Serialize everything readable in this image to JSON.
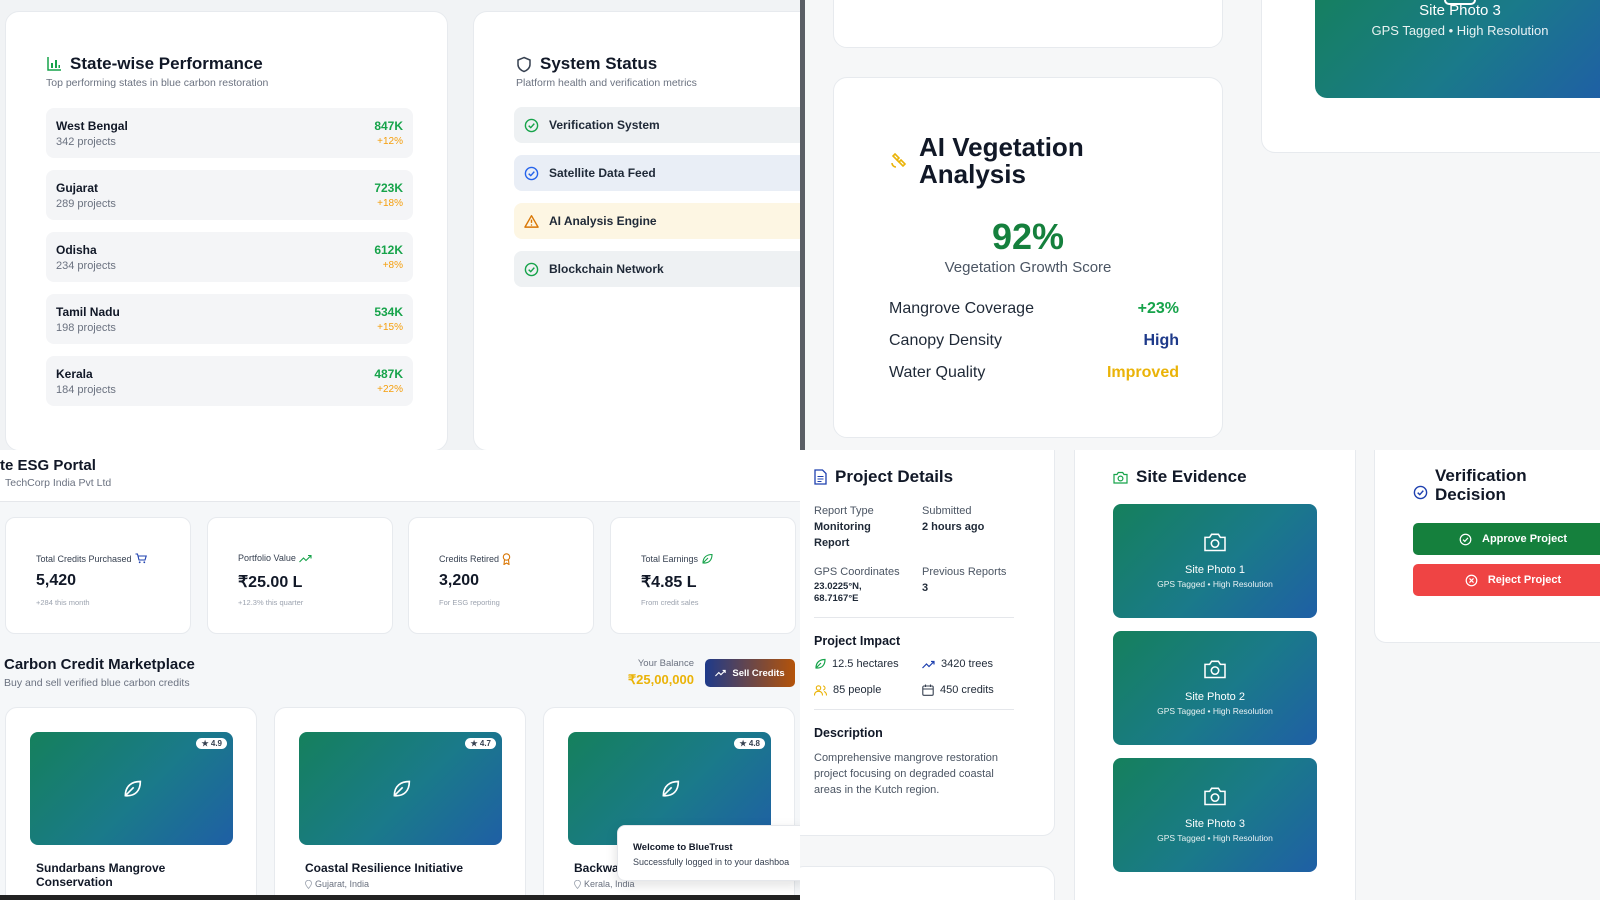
{
  "state_performance": {
    "title": "State-wise Performance",
    "subtitle": "Top performing states in blue carbon restoration",
    "states": [
      {
        "name": "West Bengal",
        "projects": "342 projects",
        "value": "847K",
        "growth": "+12%"
      },
      {
        "name": "Gujarat",
        "projects": "289 projects",
        "value": "723K",
        "growth": "+18%"
      },
      {
        "name": "Odisha",
        "projects": "234 projects",
        "value": "612K",
        "growth": "+8%"
      },
      {
        "name": "Tamil Nadu",
        "projects": "198 projects",
        "value": "534K",
        "growth": "+15%"
      },
      {
        "name": "Kerala",
        "projects": "184 projects",
        "value": "487K",
        "growth": "+22%"
      }
    ]
  },
  "system_status": {
    "title": "System Status",
    "subtitle": "Platform health and verification metrics",
    "items": [
      {
        "label": "Verification System",
        "state": "ok",
        "color": "#16a34a",
        "bg": "#eef1f3"
      },
      {
        "label": "Satellite Data Feed",
        "state": "ok",
        "color": "#2563eb",
        "bg": "#e9eef6"
      },
      {
        "label": "AI Analysis Engine",
        "state": "warning",
        "color": "#d97706",
        "bg": "#fdf6e3"
      },
      {
        "label": "Blockchain Network",
        "state": "ok",
        "color": "#16a34a",
        "bg": "#eef1f3"
      }
    ]
  },
  "ai_analysis": {
    "title_line1": "AI Vegetation",
    "title_line2": "Analysis",
    "score": "92%",
    "score_label": "Vegetation Growth Score",
    "metrics": [
      {
        "label": "Mangrove Coverage",
        "value": "+23%",
        "color": "#16a34a"
      },
      {
        "label": "Canopy Density",
        "value": "High",
        "color": "#1e3a8a"
      },
      {
        "label": "Water Quality",
        "value": "Improved",
        "color": "#eab308"
      }
    ]
  },
  "top_photo": {
    "title": "Site Photo 3",
    "subtitle": "GPS Tagged • High Resolution"
  },
  "portal": {
    "title": "te ESG Portal",
    "company": "TechCorp India Pvt Ltd",
    "metrics": [
      {
        "label": "Total Credits Purchased",
        "value": "5,420",
        "sub": "+284 this month",
        "icon": "cart-icon"
      },
      {
        "label": "Portfolio Value",
        "value": "₹25.00 L",
        "sub": "+12.3% this quarter",
        "icon": "trend-up-icon"
      },
      {
        "label": "Credits Retired",
        "value": "3,200",
        "sub": "For ESG reporting",
        "icon": "award-icon"
      },
      {
        "label": "Total Earnings",
        "value": "₹4.85 L",
        "sub": "From credit sales",
        "icon": "leaf-icon"
      }
    ],
    "marketplace": {
      "title": "Carbon Credit Marketplace",
      "subtitle": "Buy and sell verified blue carbon credits",
      "balance_label": "Your Balance",
      "balance": "₹25,00,000",
      "sell_label": "Sell Credits",
      "listings": [
        {
          "name_line1": "Sundarbans Mangrove",
          "name_line2": "Conservation",
          "location": "",
          "rating": "4.9"
        },
        {
          "name_line1": "Coastal Resilience Initiative",
          "name_line2": "",
          "location": "Gujarat, India",
          "rating": "4.7"
        },
        {
          "name_line1": "Backwat",
          "name_line2": "",
          "location": "Kerala, India",
          "rating": "4.8"
        }
      ]
    },
    "toast": {
      "title": "Welcome to BlueTrust",
      "message": "Successfully logged in to your dashboa"
    }
  },
  "project_details": {
    "title": "Project Details",
    "report_type_label": "Report Type",
    "report_type_line1": "Monitoring",
    "report_type_line2": "Report",
    "submitted_label": "Submitted",
    "submitted_value": "2 hours ago",
    "gps_label": "GPS Coordinates",
    "gps_line1": "23.0225°N,",
    "gps_line2": "68.7167°E",
    "prev_label": "Previous Reports",
    "prev_value": "3",
    "impact_title": "Project Impact",
    "impact": [
      "12.5 hectares",
      "3420 trees",
      "85 people",
      "450 credits"
    ],
    "description_title": "Description",
    "description_lines": [
      "Comprehensive mangrove restoration",
      "project focusing on degraded coastal",
      "areas in the Kutch region."
    ]
  },
  "site_evidence": {
    "title": "Site Evidence",
    "photos": [
      {
        "title": "Site Photo 1",
        "subtitle": "GPS Tagged • High Resolution"
      },
      {
        "title": "Site Photo 2",
        "subtitle": "GPS Tagged • High Resolution"
      },
      {
        "title": "Site Photo 3",
        "subtitle": "GPS Tagged • High Resolution"
      }
    ]
  },
  "verification": {
    "title_line1": "Verification",
    "title_line2": "Decision",
    "approve_label": "Approve Project",
    "reject_label": "Reject Project",
    "approve_color": "#15803d",
    "reject_color": "#ef4444"
  }
}
